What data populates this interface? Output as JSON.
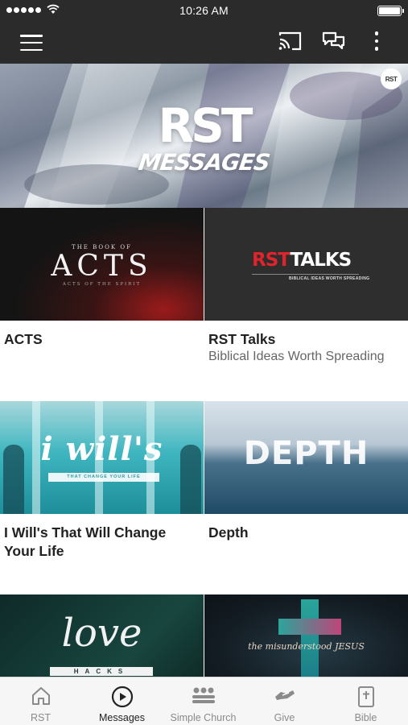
{
  "status_bar": {
    "time": "10:26 AM"
  },
  "hero": {
    "title": "RST",
    "subtitle": "MESSAGES",
    "badge": "RST"
  },
  "cards": [
    {
      "title": "ACTS",
      "subtitle": "",
      "art": {
        "small": "THE BOOK OF",
        "big": "ACTS",
        "sub": "ACTS OF THE SPIRIT"
      }
    },
    {
      "title": "RST Talks",
      "subtitle": "Biblical Ideas Worth Spreading",
      "art": {
        "red": "RST",
        "white": "TALKS",
        "small": "BIBLICAL IDEAS WORTH SPREADING"
      }
    },
    {
      "title": "I Will's That Will Change Your Life",
      "subtitle": "",
      "art": {
        "big": "i will's",
        "band": "THAT CHANGE YOUR LIFE"
      }
    },
    {
      "title": "Depth",
      "subtitle": "",
      "art": {
        "big": "DEPTH"
      }
    },
    {
      "title": "",
      "subtitle": "",
      "art": {
        "big": "love",
        "band": "HACKS"
      }
    },
    {
      "title": "",
      "subtitle": "",
      "art": {
        "small": "the misunderstood JESUS"
      }
    }
  ],
  "tabs": [
    {
      "label": "RST",
      "icon": "home-icon",
      "active": false
    },
    {
      "label": "Messages",
      "icon": "play-circle-icon",
      "active": true
    },
    {
      "label": "Simple Church",
      "icon": "group-icon",
      "active": false
    },
    {
      "label": "Give",
      "icon": "handshake-icon",
      "active": false
    },
    {
      "label": "Bible",
      "icon": "bible-icon",
      "active": false
    }
  ]
}
